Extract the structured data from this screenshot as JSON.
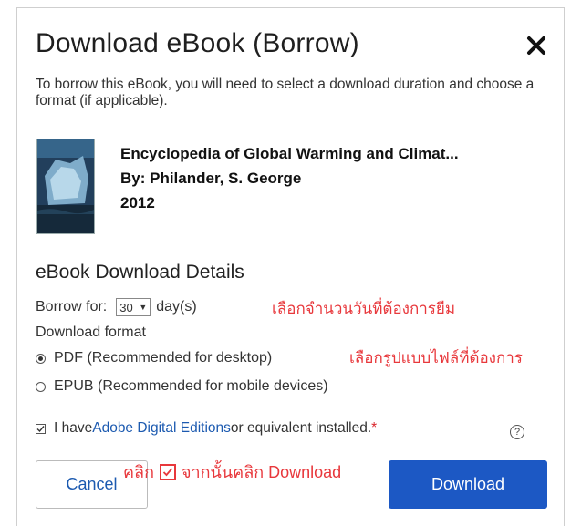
{
  "dialog": {
    "title": "Download eBook (Borrow)",
    "intro": "To borrow this eBook, you will need to select a download duration and choose a format (if applicable)."
  },
  "book": {
    "title": "Encyclopedia of Global Warming and Climat...",
    "author": "By: Philander, S. George",
    "year": "2012"
  },
  "details": {
    "heading": "eBook Download Details",
    "borrow_label": "Borrow for:",
    "borrow_value": "30",
    "borrow_unit": "day(s)",
    "format_label": "Download format",
    "formats": [
      {
        "label": "PDF (Recommended for desktop)",
        "selected": true
      },
      {
        "label": "EPUB (Recommended for mobile devices)",
        "selected": false
      }
    ],
    "confirm_prefix": "I have ",
    "confirm_link": "Adobe Digital Editions",
    "confirm_suffix": " or equivalent installed.",
    "confirm_required": "*",
    "help_symbol": "?"
  },
  "buttons": {
    "cancel": "Cancel",
    "download": "Download"
  },
  "annotations": {
    "borrow_hint": "เลือกจำนวนวันที่ต้องการยืม",
    "format_hint": "เลือกรูปแบบไฟล์ที่ต้องการ",
    "click_prefix": "คลิก",
    "click_suffix": "จากนั้นคลิก Download"
  },
  "colors": {
    "primary": "#1c58c4",
    "link": "#1c5ab0",
    "annotation": "#e8383c"
  }
}
